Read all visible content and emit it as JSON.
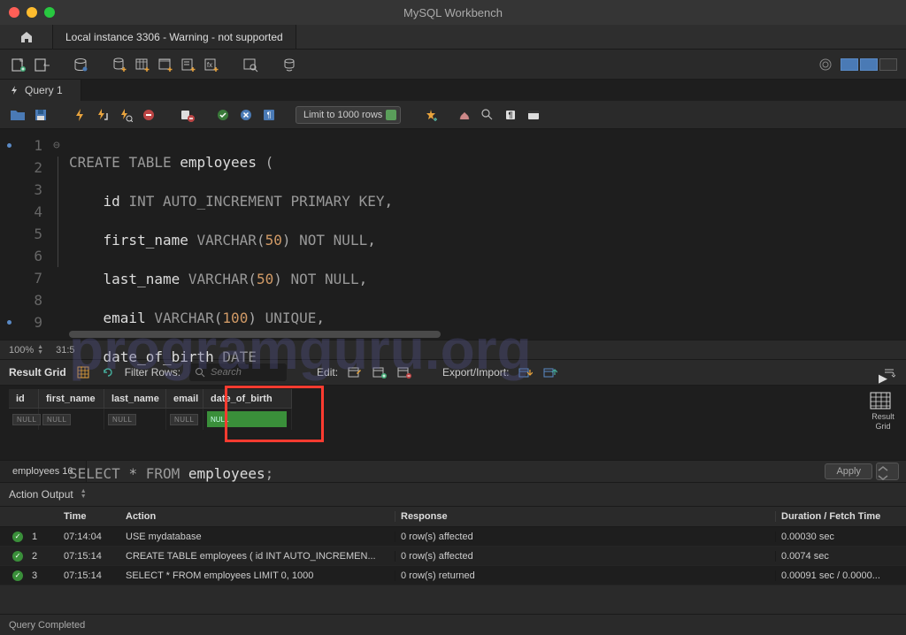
{
  "window": {
    "title": "MySQL Workbench",
    "connection_tab": "Local instance 3306 - Warning - not supported"
  },
  "query_tab": {
    "label": "Query 1"
  },
  "editor_toolbar": {
    "limit_label": "Limit to 1000 rows"
  },
  "editor": {
    "lines": [
      "CREATE TABLE employees (",
      "    id INT AUTO_INCREMENT PRIMARY KEY,",
      "    first_name VARCHAR(50) NOT NULL,",
      "    last_name VARCHAR(50) NOT NULL,",
      "    email VARCHAR(100) UNIQUE,",
      "    date_of_birth DATE",
      ");",
      "",
      "SELECT * FROM employees;"
    ],
    "line_numbers": [
      "1",
      "2",
      "3",
      "4",
      "5",
      "6",
      "7",
      "8",
      "9"
    ]
  },
  "status": {
    "zoom": "100%",
    "cursor": "31:5"
  },
  "result_toolbar": {
    "label": "Result Grid",
    "filter_label": "Filter Rows:",
    "search_placeholder": "Search",
    "edit_label": "Edit:",
    "export_label": "Export/Import:"
  },
  "result_sidebar": {
    "grid_label": "Result Grid"
  },
  "result": {
    "columns": [
      "id",
      "first_name",
      "last_name",
      "email",
      "date_of_birth"
    ],
    "null_label": "NULL",
    "tab_label": "employees 16",
    "apply_label": "Apply"
  },
  "output": {
    "header_label": "Action Output",
    "columns": {
      "time": "Time",
      "action": "Action",
      "response": "Response",
      "duration": "Duration / Fetch Time"
    },
    "rows": [
      {
        "idx": "1",
        "time": "07:14:04",
        "action": "USE mydatabase",
        "response": "0 row(s) affected",
        "duration": "0.00030 sec"
      },
      {
        "idx": "2",
        "time": "07:15:14",
        "action": "CREATE TABLE employees (     id INT AUTO_INCREMEN...",
        "response": "0 row(s) affected",
        "duration": "0.0074 sec"
      },
      {
        "idx": "3",
        "time": "07:15:14",
        "action": "SELECT * FROM employees LIMIT 0, 1000",
        "response": "0 row(s) returned",
        "duration": "0.00091 sec / 0.0000..."
      }
    ]
  },
  "footer": {
    "status": "Query Completed"
  },
  "watermark": "programguru.org"
}
